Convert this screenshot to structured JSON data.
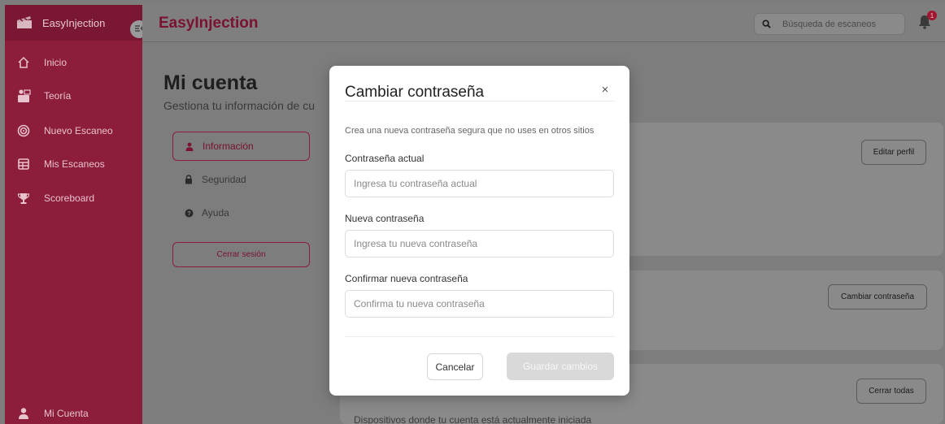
{
  "sidebar": {
    "brand": "EasyInjection",
    "items": [
      {
        "label": "Inicio",
        "icon": "home-icon"
      },
      {
        "label": "Teoría",
        "icon": "teacher-icon"
      },
      {
        "label": "Nuevo Escaneo",
        "icon": "target-icon"
      },
      {
        "label": "Mis Escaneos",
        "icon": "table-icon"
      },
      {
        "label": "Scoreboard",
        "icon": "trophy-icon"
      }
    ],
    "account": "Mi Cuenta"
  },
  "topbar": {
    "title": "EasyInjection",
    "search_placeholder": "Búsqueda de escaneos",
    "notification_count": "1"
  },
  "page": {
    "title": "Mi cuenta",
    "subtitle": "Gestiona tu información de cu",
    "tabs": [
      {
        "label": "Información",
        "active": true
      },
      {
        "label": "Seguridad",
        "active": false
      },
      {
        "label": "Ayuda",
        "active": false
      }
    ],
    "logout_label": "Cerrar sesión",
    "cards": {
      "edit_profile": "Editar perfil",
      "change_password": "Cambiar contraseña",
      "close_all": "Cerrar todas",
      "sessions_desc": "Dispositivos donde tu cuenta está actualmente iniciada"
    }
  },
  "modal": {
    "title": "Cambiar contraseña",
    "close": "×",
    "description": "Crea una nueva contraseña segura que no uses en otros sitios",
    "fields": {
      "current": {
        "label": "Contraseña actual",
        "placeholder": "Ingresa tu contraseña actual"
      },
      "new": {
        "label": "Nueva contraseña",
        "placeholder": "Ingresa tu nueva contraseña"
      },
      "confirm": {
        "label": "Confirmar nueva contraseña",
        "placeholder": "Confirma tu nueva contraseña"
      }
    },
    "cancel_label": "Cancelar",
    "save_label": "Guardar cambios"
  },
  "colors": {
    "brand": "#8c1e3c",
    "brand_text": "#7a1230",
    "modal_bg": "#ffffff"
  }
}
